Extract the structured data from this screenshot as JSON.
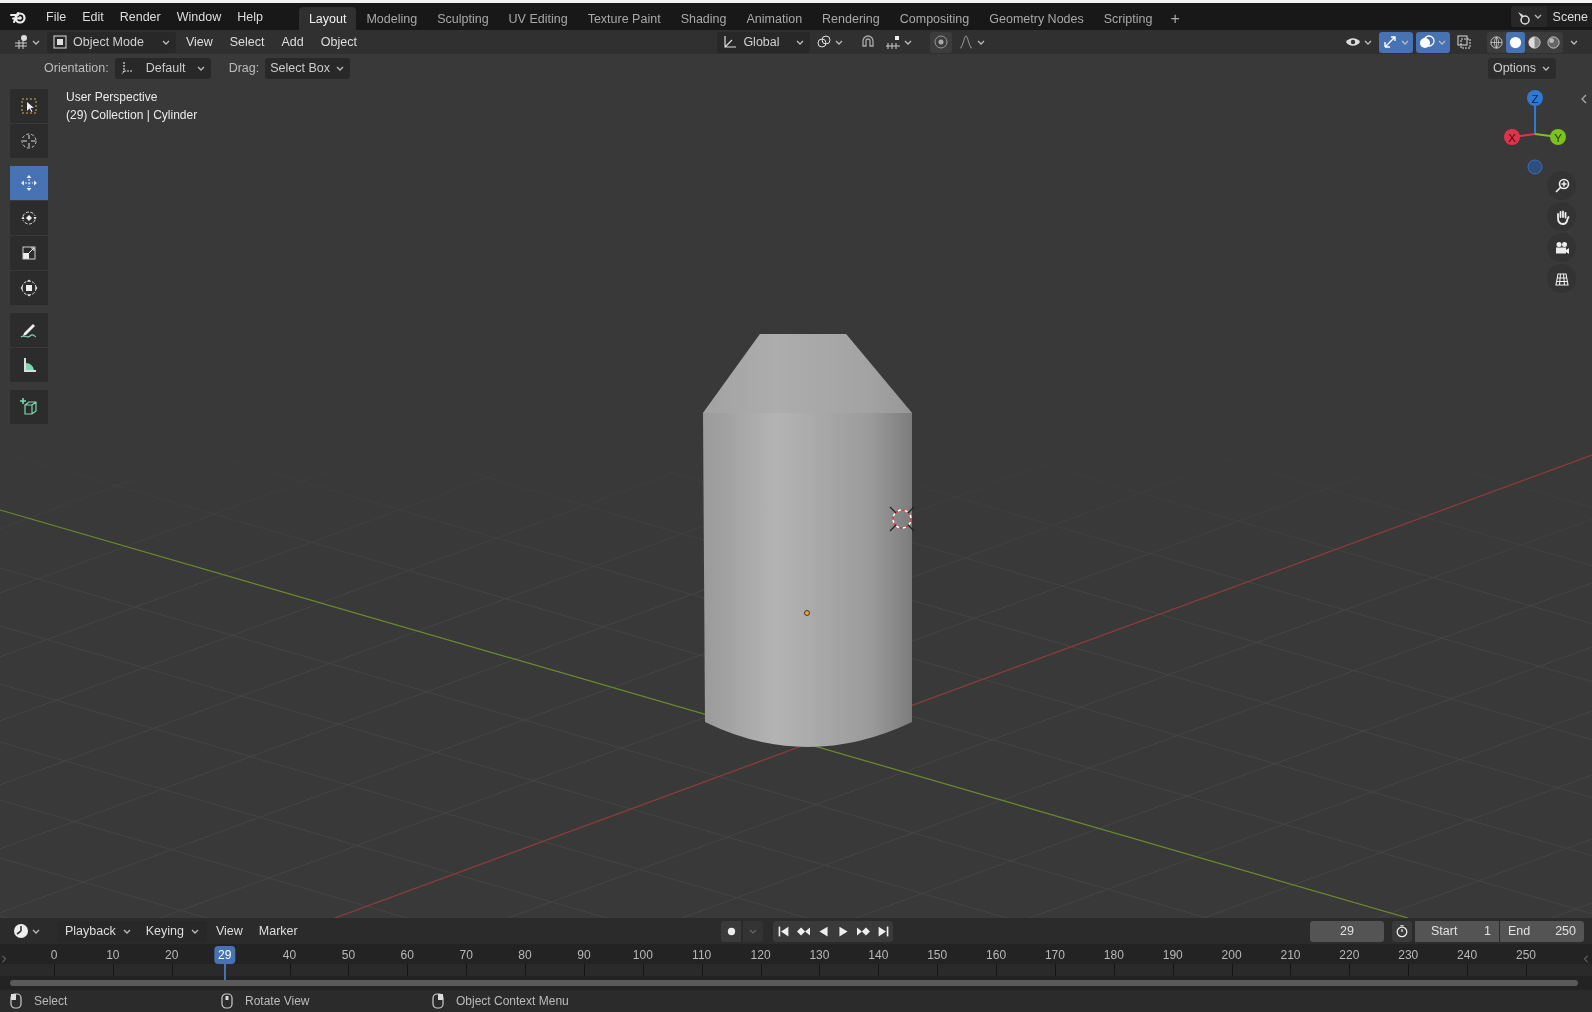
{
  "topbar": {
    "menus": [
      "File",
      "Edit",
      "Render",
      "Window",
      "Help"
    ],
    "workspaces": [
      {
        "label": "Layout",
        "selected": true
      },
      {
        "label": "Modeling",
        "selected": false
      },
      {
        "label": "Sculpting",
        "selected": false
      },
      {
        "label": "UV Editing",
        "selected": false
      },
      {
        "label": "Texture Paint",
        "selected": false
      },
      {
        "label": "Shading",
        "selected": false
      },
      {
        "label": "Animation",
        "selected": false
      },
      {
        "label": "Rendering",
        "selected": false
      },
      {
        "label": "Compositing",
        "selected": false
      },
      {
        "label": "Geometry Nodes",
        "selected": false
      },
      {
        "label": "Scripting",
        "selected": false
      }
    ],
    "add_workspace": "+",
    "scene": "Scene"
  },
  "header": {
    "mode": "Object Mode",
    "menus": [
      "View",
      "Select",
      "Add",
      "Object"
    ],
    "orientation": "Global",
    "snap_on": false,
    "proportional_on": false,
    "gizmos_on": true,
    "overlays_on": true,
    "xray_on": false,
    "shading": [
      {
        "kind": "wireframe",
        "selected": false
      },
      {
        "kind": "solid",
        "selected": true
      },
      {
        "kind": "material",
        "selected": false
      },
      {
        "kind": "rendered",
        "selected": false
      }
    ]
  },
  "tool_settings": {
    "orientation_label": "Orientation:",
    "orientation": "Default",
    "drag_label": "Drag:",
    "drag": "Select Box",
    "options": "Options"
  },
  "toolbar": [
    {
      "kind": "select_box",
      "selected": false
    },
    {
      "kind": "cursor",
      "selected": false
    },
    {
      "kind": "move",
      "selected": true
    },
    {
      "kind": "rotate",
      "selected": false
    },
    {
      "kind": "scale",
      "selected": false
    },
    {
      "kind": "transform",
      "selected": false
    },
    {
      "kind": "annotate",
      "selected": false
    },
    {
      "kind": "measure",
      "selected": false
    },
    {
      "kind": "add_cube",
      "selected": false
    }
  ],
  "viewport": {
    "view_name": "User Perspective",
    "object_info": "(29) Collection | Cylinder",
    "gizmo_axes": [
      "X",
      "Y",
      "Z"
    ]
  },
  "timeline": {
    "menus": [
      "Playback",
      "Keying",
      "View",
      "Marker"
    ],
    "auto_keying_on": false,
    "current_frame": "29",
    "start_label": "Start",
    "start": "1",
    "end_label": "End",
    "end": "250",
    "ticks_before_playhead": [
      "0",
      "10",
      "20"
    ],
    "ticks_after_playhead": [
      "40",
      "50",
      "60",
      "70",
      "80",
      "90",
      "100",
      "110",
      "120",
      "130",
      "140",
      "150",
      "160",
      "170",
      "180",
      "190",
      "200",
      "210",
      "220",
      "230",
      "240",
      "250"
    ],
    "playhead": {
      "label": "29",
      "level": 0.116
    }
  },
  "status_bar": [
    {
      "kind": "left",
      "label": "Select"
    },
    {
      "kind": "middle",
      "label": "Rotate View"
    },
    {
      "kind": "right",
      "label": "Object Context Menu"
    }
  ]
}
